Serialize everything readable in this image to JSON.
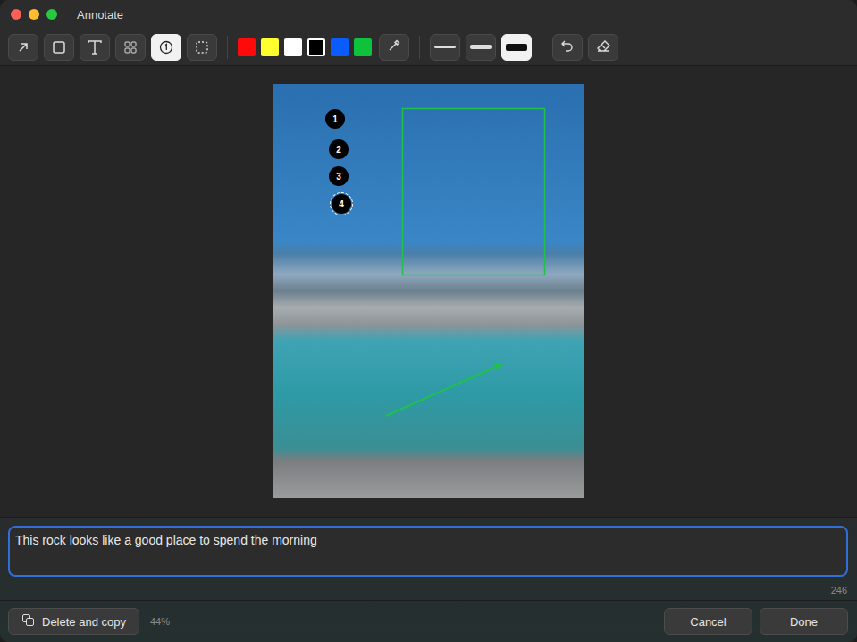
{
  "window": {
    "title": "Annotate"
  },
  "tools": [
    {
      "kind": "arrow",
      "selected": false
    },
    {
      "kind": "rectangle",
      "selected": false
    },
    {
      "kind": "text",
      "selected": false
    },
    {
      "kind": "pixelate",
      "selected": false
    },
    {
      "kind": "counter",
      "selected": true
    },
    {
      "kind": "select",
      "selected": false
    }
  ],
  "colors": [
    {
      "color": "#ff0a0a",
      "selected": false
    },
    {
      "color": "#ffff2e",
      "selected": false
    },
    {
      "color": "#ffffff",
      "selected": false
    },
    {
      "color": "#000000",
      "selected": true
    },
    {
      "color": "#0a5cff",
      "selected": false
    },
    {
      "color": "#0fc23c",
      "selected": false
    }
  ],
  "widths": [
    {
      "level": 0.2,
      "selected": false
    },
    {
      "level": 0.5,
      "selected": false
    },
    {
      "level": 1,
      "selected": true
    }
  ],
  "markers": [
    {
      "label": "1",
      "selected": false
    },
    {
      "label": "2",
      "selected": false
    },
    {
      "label": "3",
      "selected": false
    },
    {
      "label": "4",
      "selected": true
    }
  ],
  "shapes": [
    {
      "kind": "rectangle",
      "color": "#1ec24a"
    },
    {
      "kind": "arrow",
      "color": "#1ec24a"
    }
  ],
  "caption": {
    "value": "This rock looks like a good place to spend the morning",
    "focused": true
  },
  "char_count": "246",
  "zoom": "44%",
  "buttons": {
    "delete_copy": "Delete and copy",
    "cancel": "Cancel",
    "done": "Done"
  }
}
